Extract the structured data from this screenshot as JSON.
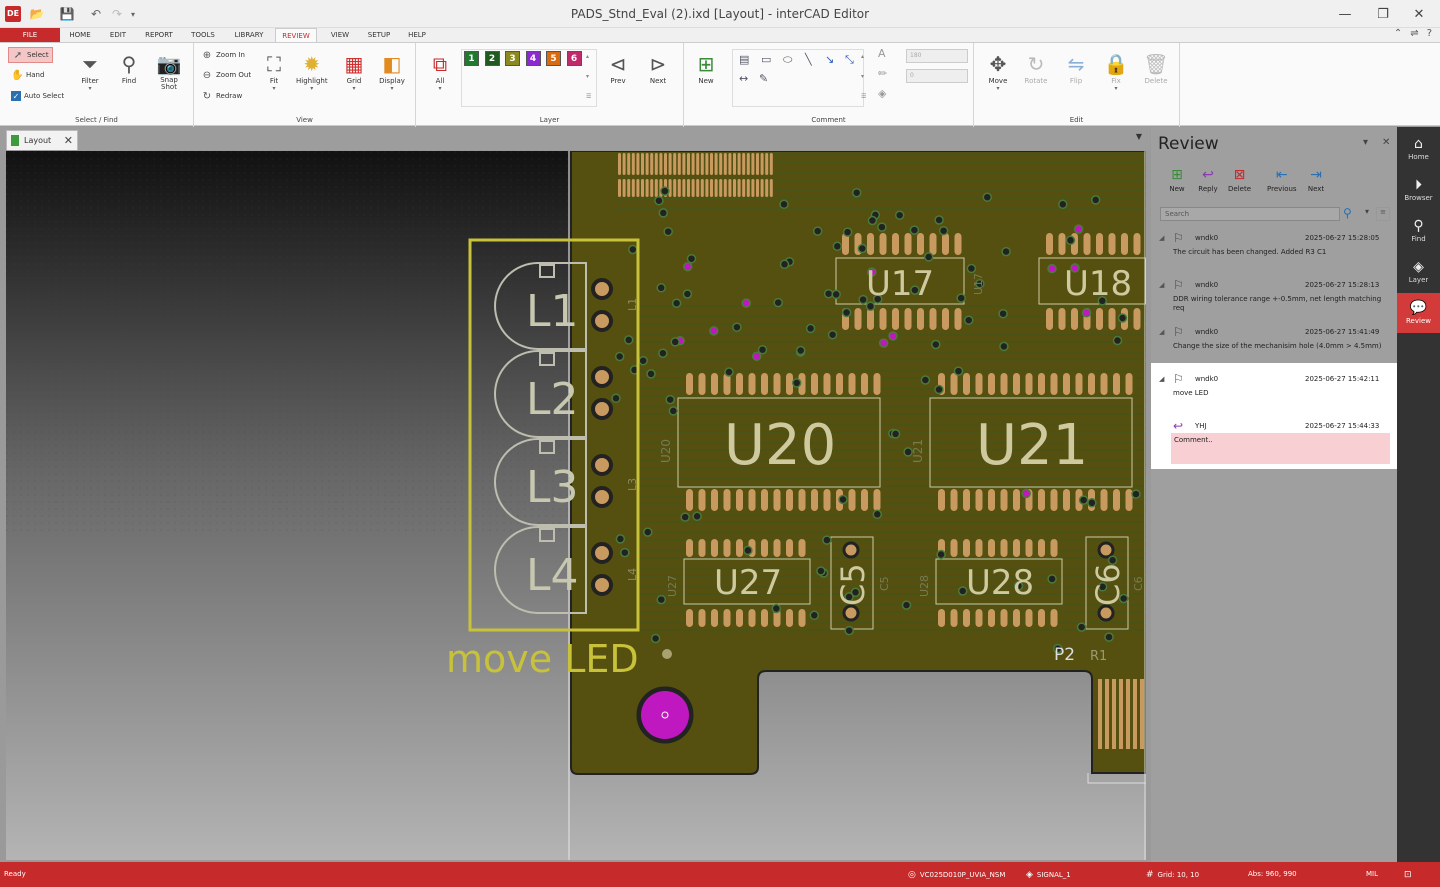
{
  "window": {
    "title": "PADS_Stnd_Eval (2).ixd [Layout] - interCAD Editor",
    "app_logo": "DE",
    "controls": [
      "—",
      "❐",
      "✕"
    ]
  },
  "ribbon_tabs": [
    "FILE",
    "HOME",
    "EDIT",
    "REPORT",
    "TOOLS",
    "LIBRARY",
    "REVIEW",
    "VIEW",
    "SETUP",
    "HELP"
  ],
  "active_tab": "REVIEW",
  "ribbon": {
    "select_find": {
      "label": "Select / Find",
      "select": "Select",
      "hand": "Hand",
      "auto_select": "Auto Select",
      "filter": "Filter",
      "find": "Find",
      "snapshot": "Snap Shot"
    },
    "view": {
      "label": "View",
      "zoom_in": "Zoom In",
      "zoom_out": "Zoom Out",
      "redraw": "Redraw",
      "fit": "Fit",
      "highlight": "Highlight",
      "grid": "Grid",
      "display": "Display"
    },
    "layer": {
      "label": "Layer",
      "all": "All",
      "layers": [
        {
          "num": "1",
          "color": "#1e7b2e"
        },
        {
          "num": "2",
          "color": "#205a20"
        },
        {
          "num": "3",
          "color": "#8a8a20"
        },
        {
          "num": "4",
          "color": "#8a2ad0"
        },
        {
          "num": "5",
          "color": "#d86a10"
        },
        {
          "num": "6",
          "color": "#c02a6a"
        }
      ],
      "prev": "Prev",
      "next": "Next"
    },
    "comment": {
      "label": "Comment",
      "new": "New",
      "size_value": "180",
      "num_value": "0"
    },
    "edit": {
      "label": "Edit",
      "move": "Move",
      "rotate": "Rotate",
      "flip": "Flip",
      "fix": "Fix",
      "delete": "Delete"
    }
  },
  "document_tab": {
    "label": "Layout",
    "more": "▼"
  },
  "canvas": {
    "labels": {
      "l1": "L1",
      "l2": "L2",
      "l3": "L3",
      "l4": "L4",
      "u17": "U17",
      "u18": "U18",
      "u20": "U20",
      "u21": "U21",
      "u27": "U27",
      "u28": "U28",
      "c5": "C5",
      "c6": "C6",
      "p2": "P2",
      "r1": "R1",
      "u20_small": "U20",
      "u21_small": "U21",
      "u27_small": "U27",
      "u28_small": "U28",
      "u17_small": "U17",
      "c5_small": "C5",
      "c6_small": "C6",
      "l1_small": "L1",
      "l3_small": "L3",
      "l4_small": "L4"
    },
    "annotation": "move LED",
    "colors": {
      "board": "#55500f",
      "annotation": "#c8c23a",
      "via": "#c018c0"
    }
  },
  "review_panel": {
    "title": "Review",
    "buttons": [
      "New",
      "Reply",
      "Delete",
      "Previous",
      "Next"
    ],
    "search_placeholder": "Search",
    "comments": [
      {
        "author": "wndk0",
        "time": "2025-06-27 15:28:05",
        "text": "The circuit has been changed. Added R3 C1"
      },
      {
        "author": "wndk0",
        "time": "2025-06-27 15:28:13",
        "text": "DDR wiring tolerance range +-0.5mm, net length matching req"
      },
      {
        "author": "wndk0",
        "time": "2025-06-27 15:41:49",
        "text": "Change the size of the mechanisim hole (4.0mm > 4.5mm)"
      },
      {
        "author": "wndk0",
        "time": "2025-06-27 15:42:11",
        "text": "move LED"
      }
    ],
    "reply": {
      "author": "YHJ",
      "time": "2025-06-27 15:44:33",
      "placeholder": "Comment.."
    }
  },
  "right_nav": [
    "Home",
    "Browser",
    "Find",
    "Layer",
    "Review"
  ],
  "active_nav": "Review",
  "status": {
    "ready": "Ready",
    "net": "VC025D010P_UVIA_NSM",
    "layer": "SIGNAL_1",
    "grid": "Grid: 10, 10",
    "abs": "Abs: 960, 990",
    "unit": "MIL"
  }
}
